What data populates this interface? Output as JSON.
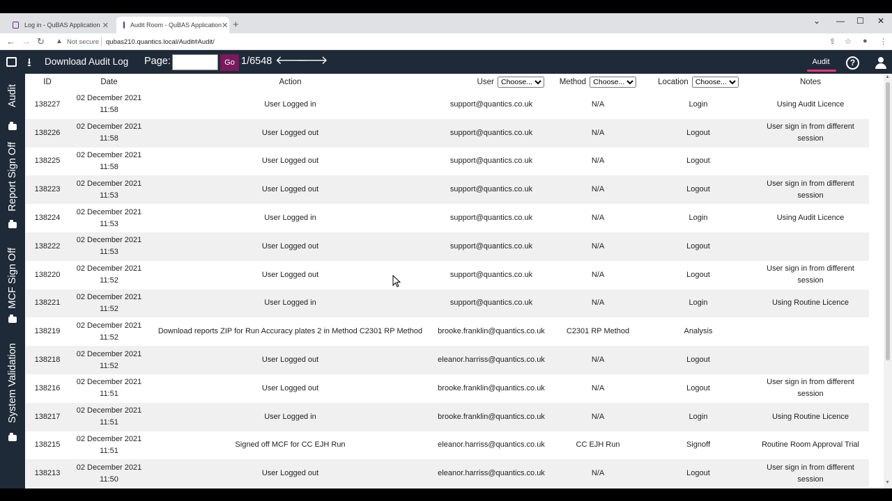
{
  "browser": {
    "tabs": [
      {
        "title": "Log in - QuBAS Application",
        "active": false
      },
      {
        "title": "Audit Room - QuBAS Application",
        "active": true
      }
    ],
    "new_tab": "+",
    "address": {
      "security": "Not secure",
      "url": "qubas210.quantics.local/Audit#Audit/"
    }
  },
  "header": {
    "download_label": "Download Audit Log",
    "page_label": "Page:",
    "page_input_value": "",
    "go_label": "Go",
    "page_count": "1/6548",
    "audit_tab_label": "Audit",
    "help_label": "?",
    "accent_color": "#e8357a",
    "go_color": "#7a1a5c"
  },
  "sidebar": {
    "items": [
      {
        "label": "Audit",
        "active": true
      },
      {
        "label": "Report Sign Off",
        "active": false
      },
      {
        "label": "MCF Sign Off",
        "active": false
      },
      {
        "label": "System Validation",
        "active": false
      }
    ]
  },
  "table": {
    "headers": {
      "id": "ID",
      "date": "Date",
      "action": "Action",
      "user": "User",
      "method": "Method",
      "location": "Location",
      "notes": "Notes"
    },
    "filter_placeholder": "Choose...",
    "rows": [
      {
        "id": "138227",
        "date": "02 December 2021",
        "time": "11:58",
        "action": "User Logged in",
        "user": "support@quantics.co.uk",
        "method": "N/A",
        "location": "Login",
        "notes": "Using Audit Licence"
      },
      {
        "id": "138226",
        "date": "02 December 2021",
        "time": "11:58",
        "action": "User Logged out",
        "user": "support@quantics.co.uk",
        "method": "N/A",
        "location": "Logout",
        "notes": "User sign in from different session"
      },
      {
        "id": "138225",
        "date": "02 December 2021",
        "time": "11:58",
        "action": "User Logged out",
        "user": "support@quantics.co.uk",
        "method": "N/A",
        "location": "Logout",
        "notes": ""
      },
      {
        "id": "138223",
        "date": "02 December 2021",
        "time": "11:53",
        "action": "User Logged out",
        "user": "support@quantics.co.uk",
        "method": "N/A",
        "location": "Logout",
        "notes": "User sign in from different session"
      },
      {
        "id": "138224",
        "date": "02 December 2021",
        "time": "11:53",
        "action": "User Logged in",
        "user": "support@quantics.co.uk",
        "method": "N/A",
        "location": "Login",
        "notes": "Using Audit Licence"
      },
      {
        "id": "138222",
        "date": "02 December 2021",
        "time": "11:53",
        "action": "User Logged out",
        "user": "support@quantics.co.uk",
        "method": "N/A",
        "location": "Logout",
        "notes": ""
      },
      {
        "id": "138220",
        "date": "02 December 2021",
        "time": "11:52",
        "action": "User Logged out",
        "user": "support@quantics.co.uk",
        "method": "N/A",
        "location": "Logout",
        "notes": "User sign in from different session"
      },
      {
        "id": "138221",
        "date": "02 December 2021",
        "time": "11:52",
        "action": "User Logged in",
        "user": "support@quantics.co.uk",
        "method": "N/A",
        "location": "Login",
        "notes": "Using Routine Licence"
      },
      {
        "id": "138219",
        "date": "02 December 2021",
        "time": "11:52",
        "action": "Download reports ZIP for Run Accuracy plates 2 in Method C2301 RP Method",
        "user": "brooke.franklin@quantics.co.uk",
        "method": "C2301 RP Method",
        "location": "Analysis",
        "notes": ""
      },
      {
        "id": "138218",
        "date": "02 December 2021",
        "time": "11:52",
        "action": "User Logged out",
        "user": "eleanor.harriss@quantics.co.uk",
        "method": "N/A",
        "location": "Logout",
        "notes": ""
      },
      {
        "id": "138216",
        "date": "02 December 2021",
        "time": "11:51",
        "action": "User Logged out",
        "user": "brooke.franklin@quantics.co.uk",
        "method": "N/A",
        "location": "Logout",
        "notes": "User sign in from different session"
      },
      {
        "id": "138217",
        "date": "02 December 2021",
        "time": "11:51",
        "action": "User Logged in",
        "user": "brooke.franklin@quantics.co.uk",
        "method": "N/A",
        "location": "Login",
        "notes": "Using Routine Licence"
      },
      {
        "id": "138215",
        "date": "02 December 2021",
        "time": "11:51",
        "action": "Signed off MCF for CC EJH Run",
        "user": "eleanor.harriss@quantics.co.uk",
        "method": "CC EJH Run",
        "location": "Signoff",
        "notes": "Routine Room Approval Trial"
      },
      {
        "id": "138213",
        "date": "02 December 2021",
        "time": "11:50",
        "action": "User Logged out",
        "user": "eleanor.harriss@quantics.co.uk",
        "method": "N/A",
        "location": "Logout",
        "notes": "User sign in from different session"
      }
    ]
  }
}
